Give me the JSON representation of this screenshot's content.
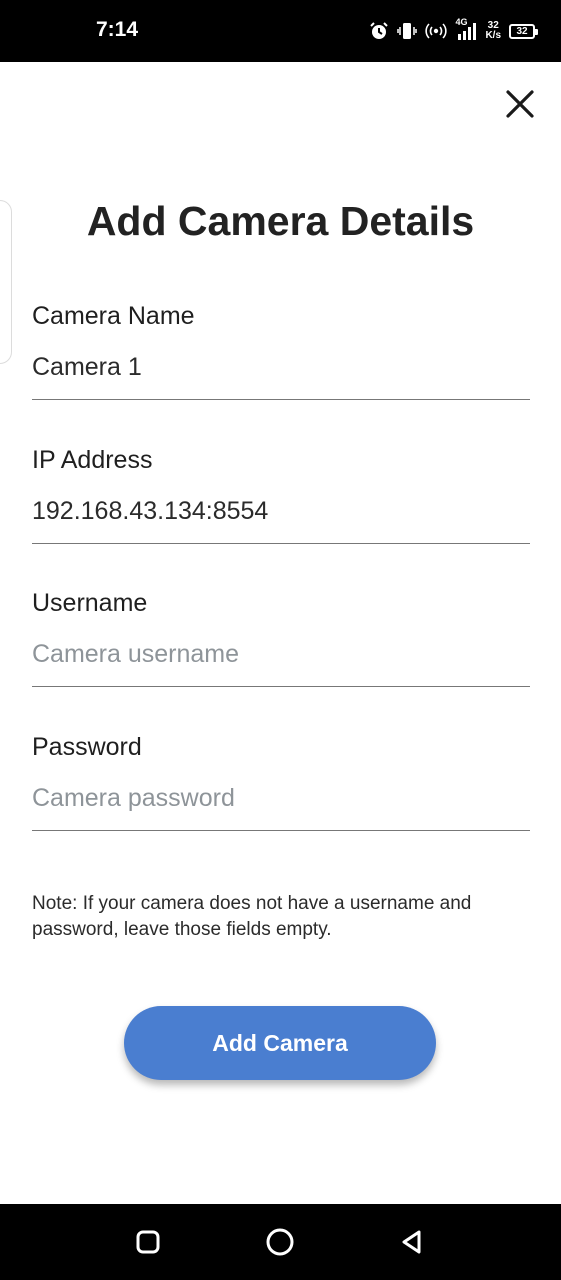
{
  "status_bar": {
    "time": "7:14",
    "network_type": "4G",
    "speed_value": "32",
    "speed_unit": "K/s",
    "battery": "32",
    "icons": [
      "alarm-icon",
      "vibrate-icon",
      "hotspot-icon",
      "signal-icon",
      "battery-icon"
    ]
  },
  "dialog": {
    "close_icon": "close-icon",
    "title": "Add Camera Details",
    "fields": [
      {
        "label": "Camera Name",
        "value": "Camera 1",
        "placeholder": ""
      },
      {
        "label": "IP Address",
        "value": "192.168.43.134:8554",
        "placeholder": ""
      },
      {
        "label": "Username",
        "value": "",
        "placeholder": "Camera username"
      },
      {
        "label": "Password",
        "value": "",
        "placeholder": "Camera password"
      }
    ],
    "note": "Note: If your camera does not have a username and password, leave those fields empty.",
    "submit_label": "Add Camera"
  },
  "colors": {
    "accent": "#4a7ed0",
    "status_bar_bg": "#000000",
    "placeholder": "#8e9499"
  },
  "nav_bar": {
    "icons": [
      "recent-apps-icon",
      "home-icon",
      "back-icon"
    ]
  }
}
